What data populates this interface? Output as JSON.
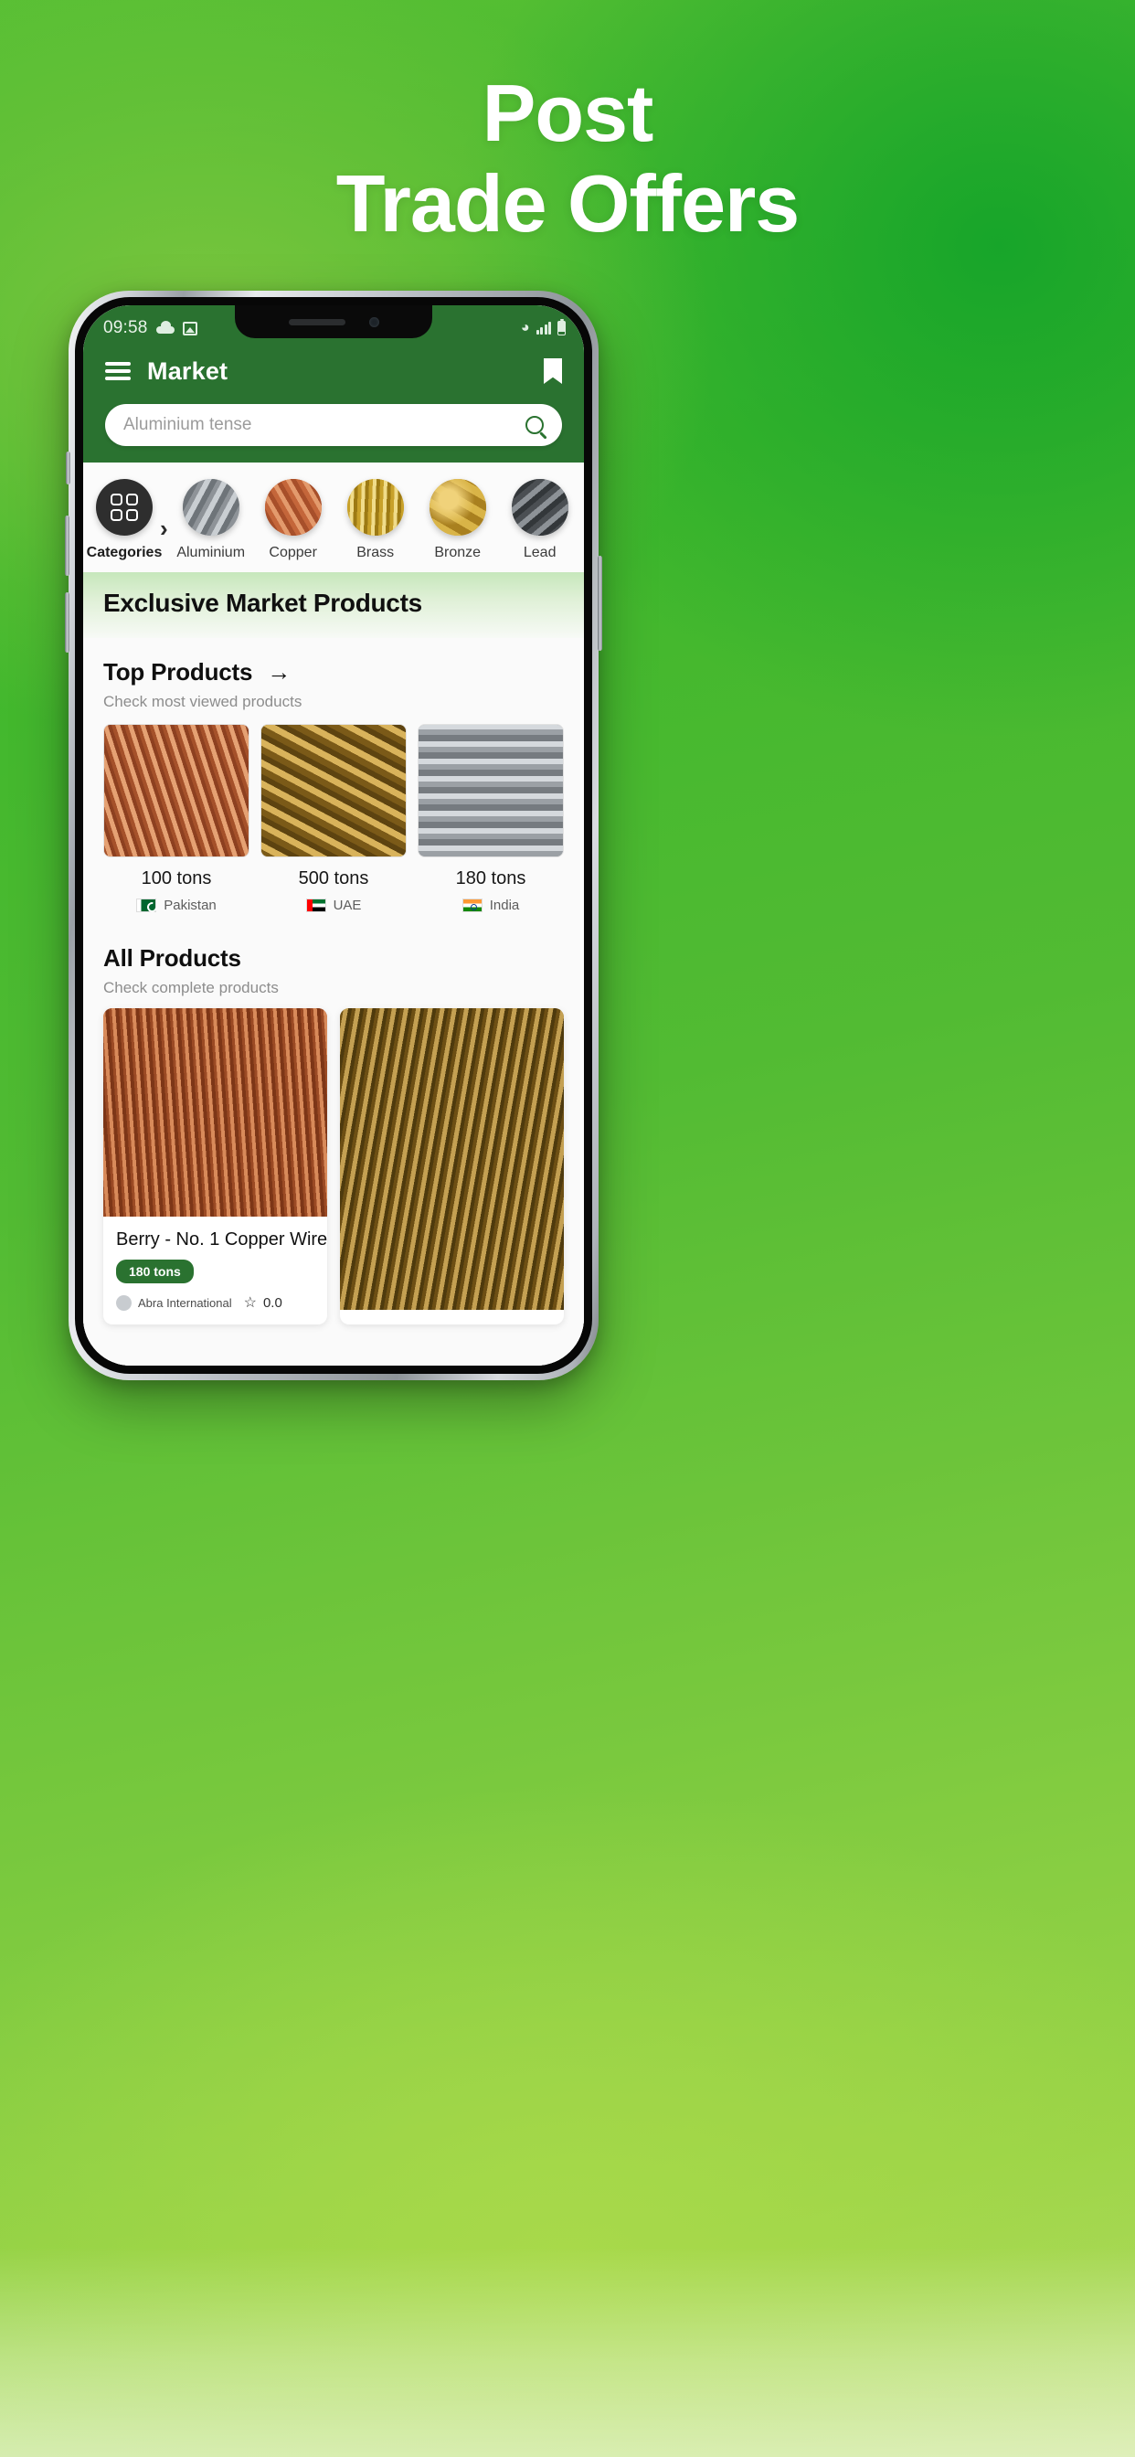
{
  "promo": {
    "headline_line1": "Post",
    "headline_line2": "Trade Offers"
  },
  "phone": {
    "status_bar": {
      "time": "09:58",
      "cloud_icon": "cloud-icon",
      "image_icon": "image-icon",
      "wifi_icon": "wifi-icon",
      "signal_icon": "signal-bars-icon",
      "battery_icon": "battery-icon"
    },
    "app_bar": {
      "menu_icon": "hamburger-menu-icon",
      "title": "Market",
      "bookmark_icon": "bookmark-icon"
    },
    "search": {
      "placeholder": "Aluminium tense",
      "search_icon": "search-icon"
    },
    "categories": {
      "first_label": "Categories",
      "chevron": "›",
      "items": [
        {
          "label": "Aluminium"
        },
        {
          "label": "Copper"
        },
        {
          "label": "Brass"
        },
        {
          "label": "Bronze"
        },
        {
          "label": "Lead"
        }
      ]
    },
    "exclusive_banner": "Exclusive Market Products",
    "top_products": {
      "title": "Top Products",
      "arrow": "→",
      "subtitle": "Check most viewed products",
      "items": [
        {
          "tons": "100 tons",
          "country": "Pakistan"
        },
        {
          "tons": "500 tons",
          "country": "UAE"
        },
        {
          "tons": "180 tons",
          "country": "India"
        }
      ]
    },
    "all_products": {
      "title": "All Products",
      "subtitle": "Check complete products",
      "items": [
        {
          "name": "Berry - No. 1 Copper Wire",
          "tons_badge": "180 tons",
          "seller": "Abra International",
          "rating": "0.0",
          "star_icon": "star-icon"
        }
      ]
    }
  },
  "colors": {
    "brand_green": "#2a7230",
    "background_green": "#4fba30",
    "badge_green": "#2a7230"
  }
}
